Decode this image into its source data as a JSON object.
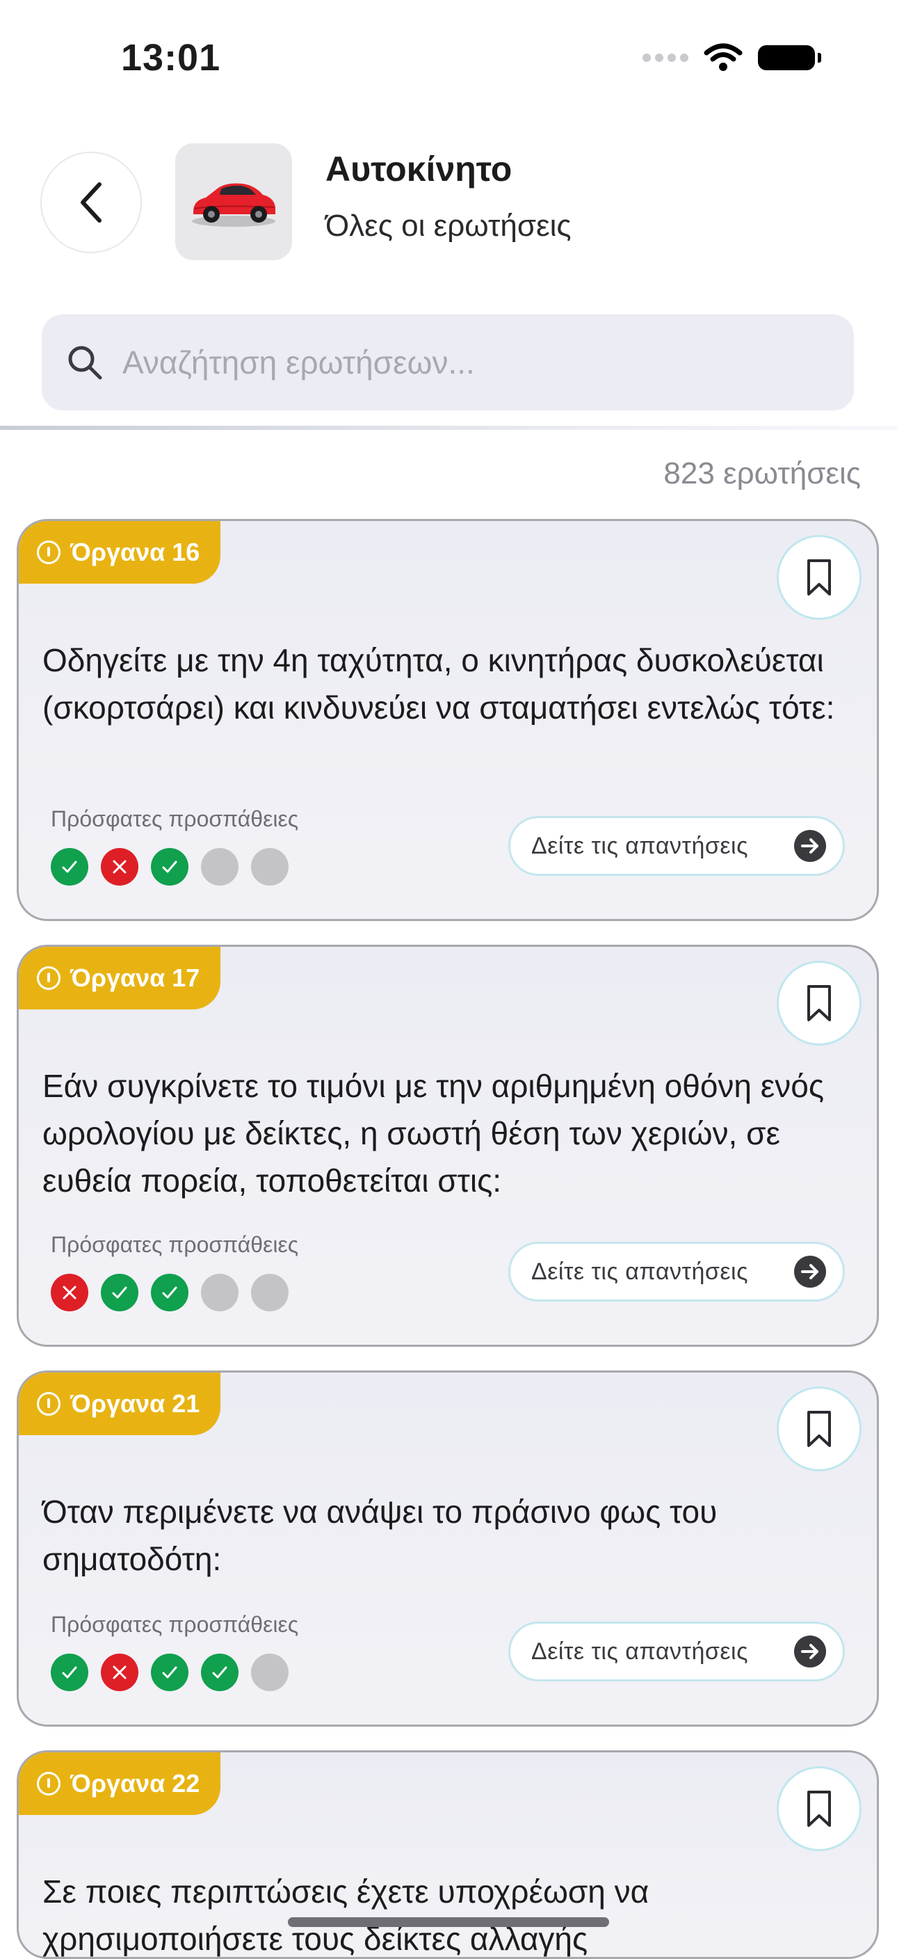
{
  "status_bar": {
    "time": "13:01"
  },
  "header": {
    "title": "Αυτοκίνητο",
    "subtitle": "Όλες οι ερωτήσεις",
    "thumbnail_icon": "red-car-icon"
  },
  "search": {
    "placeholder": "Αναζήτηση ερωτήσεων..."
  },
  "count_label": "823 ερωτήσεις",
  "colors": {
    "tag": "#e8b312",
    "correct": "#10a04e",
    "wrong": "#de1f26",
    "empty": "#c4c4c8"
  },
  "cards": [
    {
      "tag": "Όργανα 16",
      "question": "Οδηγείτε με την 4η ταχύτητα, ο κινητήρας δυσκολεύεται (σκορτσάρει) και κινδυνεύει να σταματήσει εντελώς τότε:",
      "attempts_label": "Πρόσφατες προσπάθειες",
      "attempts": [
        "correct",
        "wrong",
        "correct",
        "none",
        "none"
      ],
      "button_label": "Δείτε τις απαντήσεις"
    },
    {
      "tag": "Όργανα 17",
      "question": "Εάν συγκρίνετε το τιμόνι με την αριθμημένη οθόνη ενός ωρολογίου με δείκτες, η σωστή θέση των χεριών, σε ευθεία πορεία, τοποθετείται στις:",
      "attempts_label": "Πρόσφατες προσπάθειες",
      "attempts": [
        "wrong",
        "correct",
        "correct",
        "none",
        "none"
      ],
      "button_label": "Δείτε τις απαντήσεις"
    },
    {
      "tag": "Όργανα 21",
      "question": "Όταν περιμένετε να ανάψει το πράσινο φως του σηματοδότη:",
      "attempts_label": "Πρόσφατες προσπάθειες",
      "attempts": [
        "correct",
        "wrong",
        "correct",
        "correct",
        "none"
      ],
      "button_label": "Δείτε τις απαντήσεις"
    },
    {
      "tag": "Όργανα 22",
      "question": "Σε ποιες περιπτώσεις έχετε υποχρέωση να χρησιμοποιήσετε τους δείκτες αλλαγής"
    }
  ]
}
